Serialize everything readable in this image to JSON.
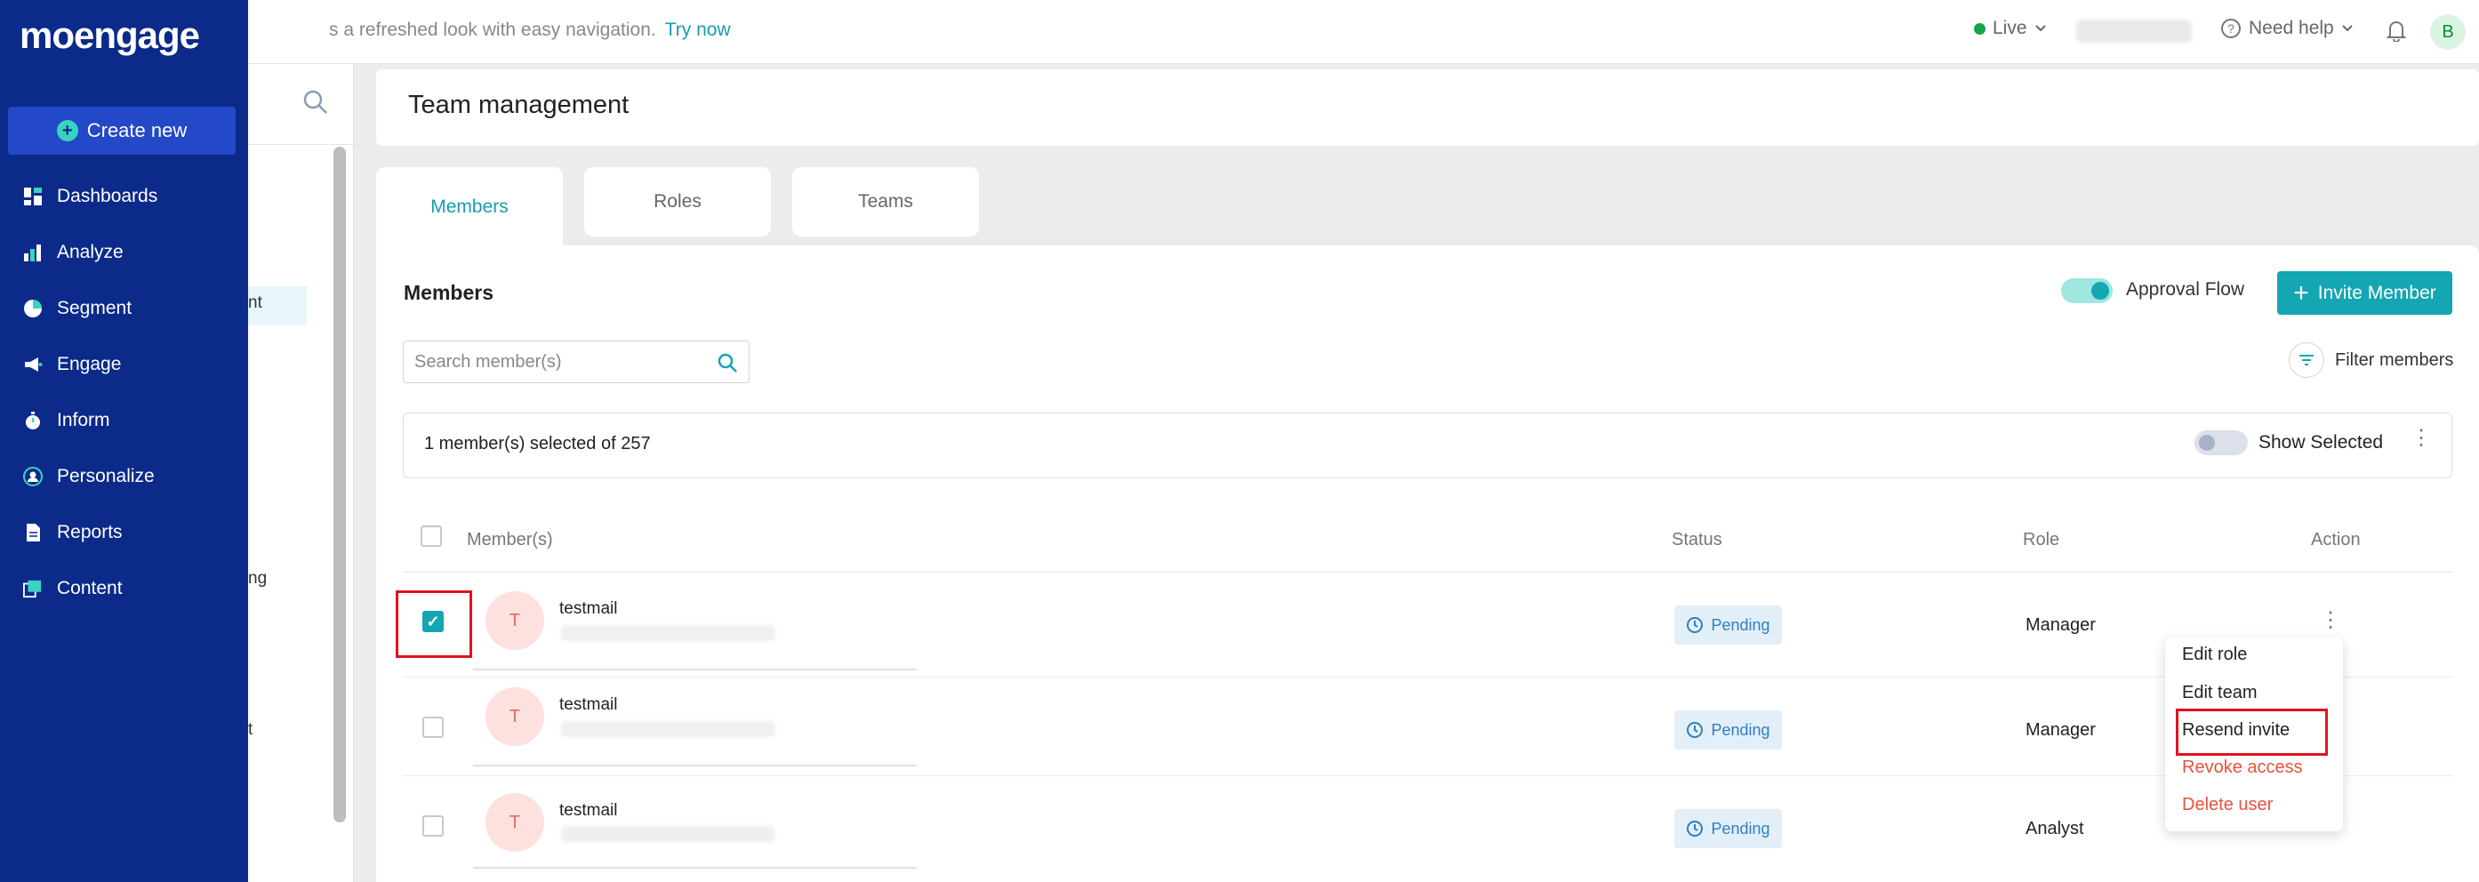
{
  "topbar": {
    "banner_text": "s a refreshed look with easy navigation.",
    "banner_link": "Try now",
    "environment": "Live",
    "help": "Need help",
    "avatar_initial": "B"
  },
  "nav": {
    "logo": "moengage",
    "create_new": "Create new",
    "items": [
      {
        "label": "Dashboards",
        "icon": "dashboard-icon"
      },
      {
        "label": "Analyze",
        "icon": "bar-chart-icon"
      },
      {
        "label": "Segment",
        "icon": "pie-chart-icon"
      },
      {
        "label": "Engage",
        "icon": "megaphone-icon"
      },
      {
        "label": "Inform",
        "icon": "stopwatch-icon"
      },
      {
        "label": "Personalize",
        "icon": "person-icon"
      },
      {
        "label": "Reports",
        "icon": "document-icon"
      },
      {
        "label": "Content",
        "icon": "stack-icon"
      }
    ]
  },
  "subpanel": {
    "fragments": [
      "nt",
      "ng",
      "t"
    ]
  },
  "page": {
    "title": "Team management",
    "tabs": [
      "Members",
      "Roles",
      "Teams"
    ],
    "active_tab": "Members"
  },
  "members": {
    "heading": "Members",
    "approval_flow_label": "Approval Flow",
    "approval_flow_on": true,
    "invite_button": "Invite Member",
    "search_placeholder": "Search member(s)",
    "filter_label": "Filter members",
    "selection_text": "1 member(s) selected of 257",
    "show_selected_label": "Show Selected",
    "show_selected_on": false
  },
  "table": {
    "columns": [
      "Member(s)",
      "Status",
      "Role",
      "Action"
    ],
    "rows": [
      {
        "initial": "T",
        "name": "testmail",
        "status": "Pending",
        "role": "Manager",
        "checked": true
      },
      {
        "initial": "T",
        "name": "testmail",
        "status": "Pending",
        "role": "Manager",
        "checked": false
      },
      {
        "initial": "T",
        "name": "testmail",
        "status": "Pending",
        "role": "Analyst",
        "checked": false
      }
    ]
  },
  "action_menu": {
    "items": [
      "Edit role",
      "Edit team",
      "Resend invite",
      "Revoke access",
      "Delete user"
    ]
  },
  "colors": {
    "nav_bg": "#0b2a8a",
    "accent": "#14a6b2",
    "danger": "#e5533d",
    "highlight": "#e0131e"
  }
}
